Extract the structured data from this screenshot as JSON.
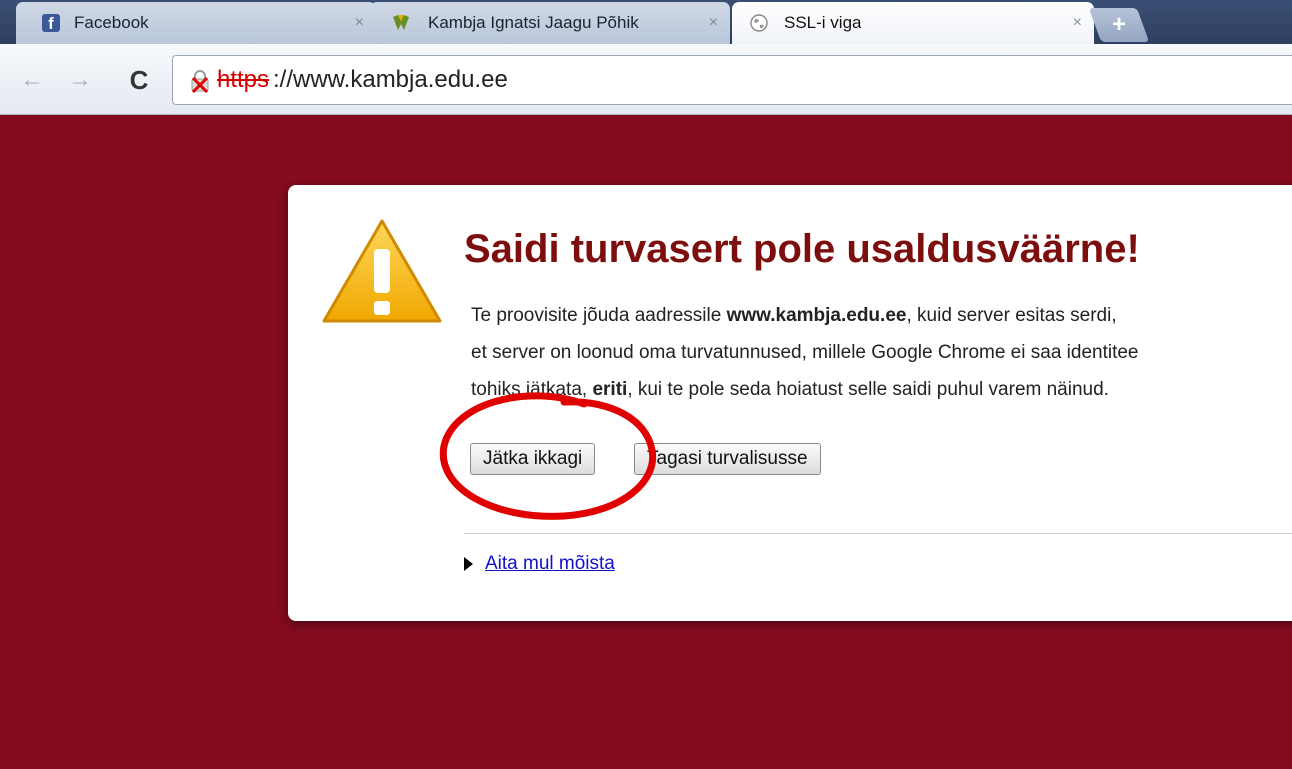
{
  "tabs": [
    {
      "title": "Facebook",
      "favicon": "facebook-icon",
      "active": false
    },
    {
      "title": "Kambja Ignatsi Jaagu Põhik",
      "favicon": "kambja-crest-icon",
      "active": false
    },
    {
      "title": "SSL-i viga",
      "favicon": "globe-icon",
      "active": true
    }
  ],
  "toolbar": {
    "url_scheme": "https",
    "url_rest": "://www.kambja.edu.ee"
  },
  "interstitial": {
    "heading": "Saidi turvasert pole usaldusväärne!",
    "line1_a": "Te proovisite jõuda aadressile ",
    "line1_host": "www.kambja.edu.ee",
    "line1_b": ", kuid server esitas serdi,",
    "line2": "et server on loonud oma turvatunnused, millele Google Chrome ei saa identitee",
    "line3_a": "tohiks jätkata, ",
    "line3_bold": "eriti",
    "line3_b": ", kui te pole seda hoiatust selle saidi puhul varem näinud.",
    "proceed_label": "Jätka ikkagi",
    "back_label": "Tagasi turvalisusse",
    "help_label": "Aita mul mõista"
  },
  "colors": {
    "page_background": "#850b1f",
    "heading": "#7c0e0e",
    "annotation": "#e00000"
  }
}
